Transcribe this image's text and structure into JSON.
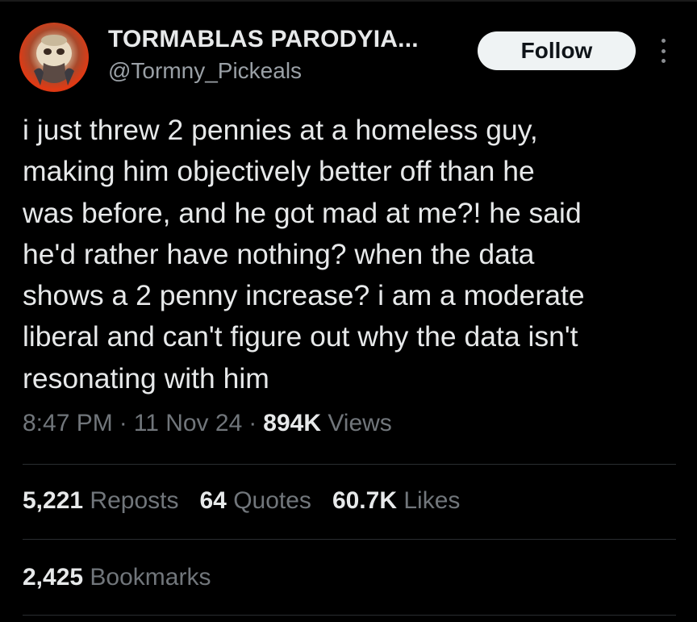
{
  "author": {
    "display_name": "TORMABLAS PARODYIA...",
    "handle": "@Tormny_Pickeals",
    "avatar_icon": "profile-avatar-image"
  },
  "actions": {
    "follow_label": "Follow",
    "more_icon": "more-vertical-icon"
  },
  "tweet": {
    "lines": [
      "i just threw 2 pennies at a homeless guy,",
      "making him objectively better off than he",
      "was before, and he got mad at me?! he said",
      "he'd rather have nothing? when the data",
      "shows a 2 penny increase? i am a moderate",
      "liberal and can't figure out why the data isn't",
      "resonating with him"
    ]
  },
  "meta": {
    "time": "8:47 PM",
    "separator": "·",
    "date": "11 Nov 24",
    "views_count": "894K",
    "views_label": "Views"
  },
  "stats": {
    "reposts_count": "5,221",
    "reposts_label": "Reposts",
    "quotes_count": "64",
    "quotes_label": "Quotes",
    "likes_count": "60.7K",
    "likes_label": "Likes",
    "bookmarks_count": "2,425",
    "bookmarks_label": "Bookmarks"
  },
  "colors": {
    "background": "#000000",
    "primary_text": "#e7e9ea",
    "secondary_text": "#71767b",
    "follow_button_bg": "#eff3f4"
  }
}
